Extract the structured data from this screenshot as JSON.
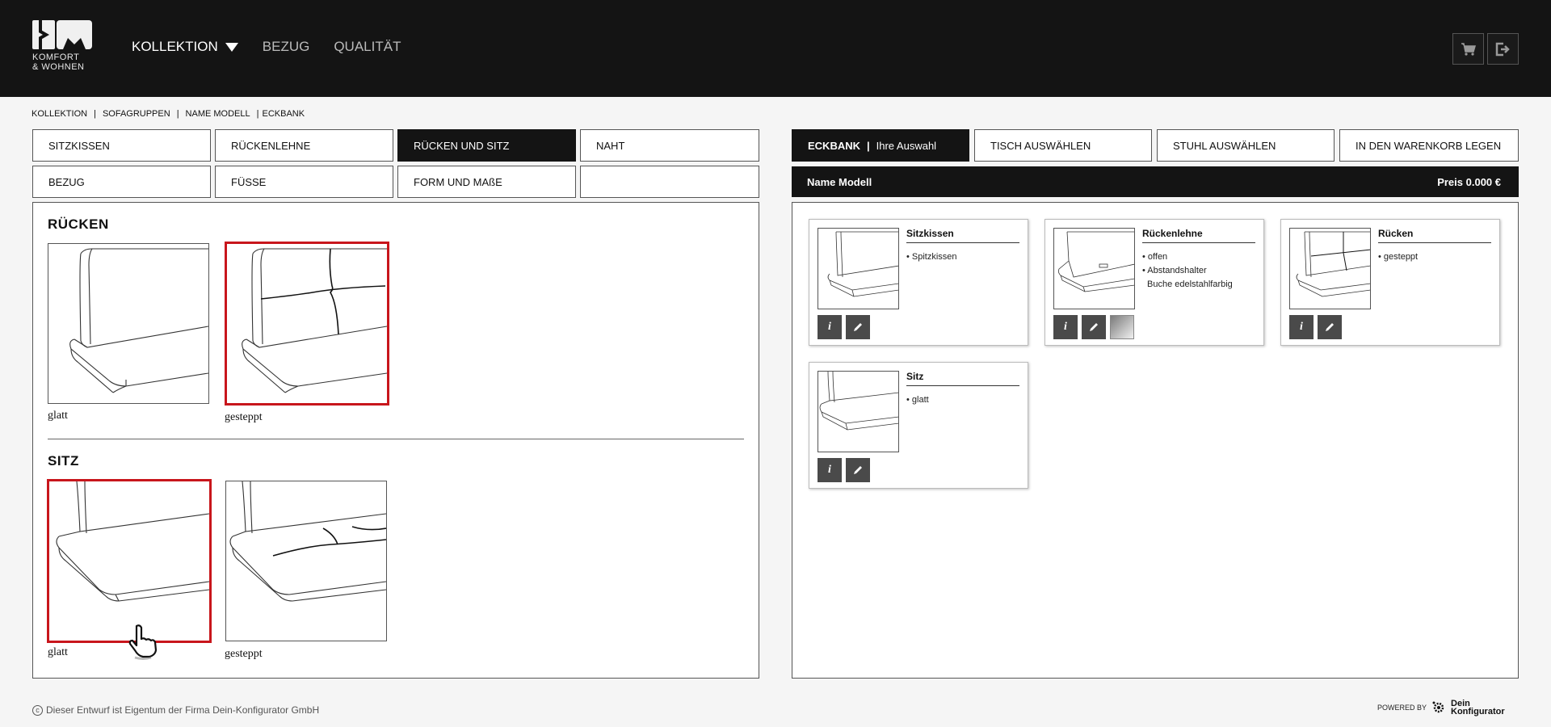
{
  "header": {
    "logo_text_line1": "KOMFORT",
    "logo_text_line2": "& WOHNEN",
    "nav": [
      {
        "label": "KOLLEKTION"
      },
      {
        "label": "BEZUG"
      },
      {
        "label": "QUALITÄT"
      }
    ],
    "cart_icon": "cart-icon",
    "logout_icon": "logout-icon"
  },
  "breadcrumb": [
    "KOLLEKTION",
    "SOFAGRUPPEN",
    "NAME MODELL",
    "ECKBANK"
  ],
  "left_tabs": [
    {
      "label": "SITZKISSEN"
    },
    {
      "label": "RÜCKENLEHNE"
    },
    {
      "label": "RÜCKEN UND SITZ"
    },
    {
      "label": "NAHT"
    },
    {
      "label": "BEZUG"
    },
    {
      "label": "FÜSSE"
    },
    {
      "label": "FORM UND MAßE"
    },
    {
      "label": ""
    }
  ],
  "left_active_tab": "RÜCKEN UND SITZ",
  "right_tabs": {
    "eckbank_label": "ECKBANK",
    "eckbank_sub": "Ihre Auswahl",
    "tisch": "TISCH AUSWÄHLEN",
    "stuhl": "STUHL AUSWÄHLEN",
    "warenkorb": "IN DEN WARENKORB LEGEN"
  },
  "ruecken": {
    "title": "RÜCKEN",
    "options": [
      {
        "label": "glatt",
        "selected": false
      },
      {
        "label": "gesteppt",
        "selected": true
      }
    ]
  },
  "sitz": {
    "title": "SITZ",
    "options": [
      {
        "label": "glatt",
        "selected": true
      },
      {
        "label": "gesteppt",
        "selected": false
      }
    ]
  },
  "summary": {
    "name": "Name Modell",
    "price": "Preis 0.000 €",
    "cards": [
      {
        "title": "Sitzkissen",
        "items": [
          "• Spitzkissen"
        ]
      },
      {
        "title": "Rückenlehne",
        "items": [
          "• offen",
          "• Abstandshalter",
          "Buche edelstahlfarbig"
        ]
      },
      {
        "title": "Rücken",
        "items": [
          "• gesteppt"
        ]
      },
      {
        "title": "Sitz",
        "items": [
          "• glatt"
        ]
      }
    ]
  },
  "footer": {
    "copyright_symbol": "c",
    "copyright": "Dieser Entwurf ist Eigentum der Firma Dein-Konfigurator GmbH",
    "powered_by": "POWERED BY",
    "brand_line1": "Dein",
    "brand_line2": "Konfigurator"
  },
  "colors": {
    "header_bg": "#141414",
    "selected_border": "#c8161c",
    "button_dark": "#4a4a4a"
  }
}
